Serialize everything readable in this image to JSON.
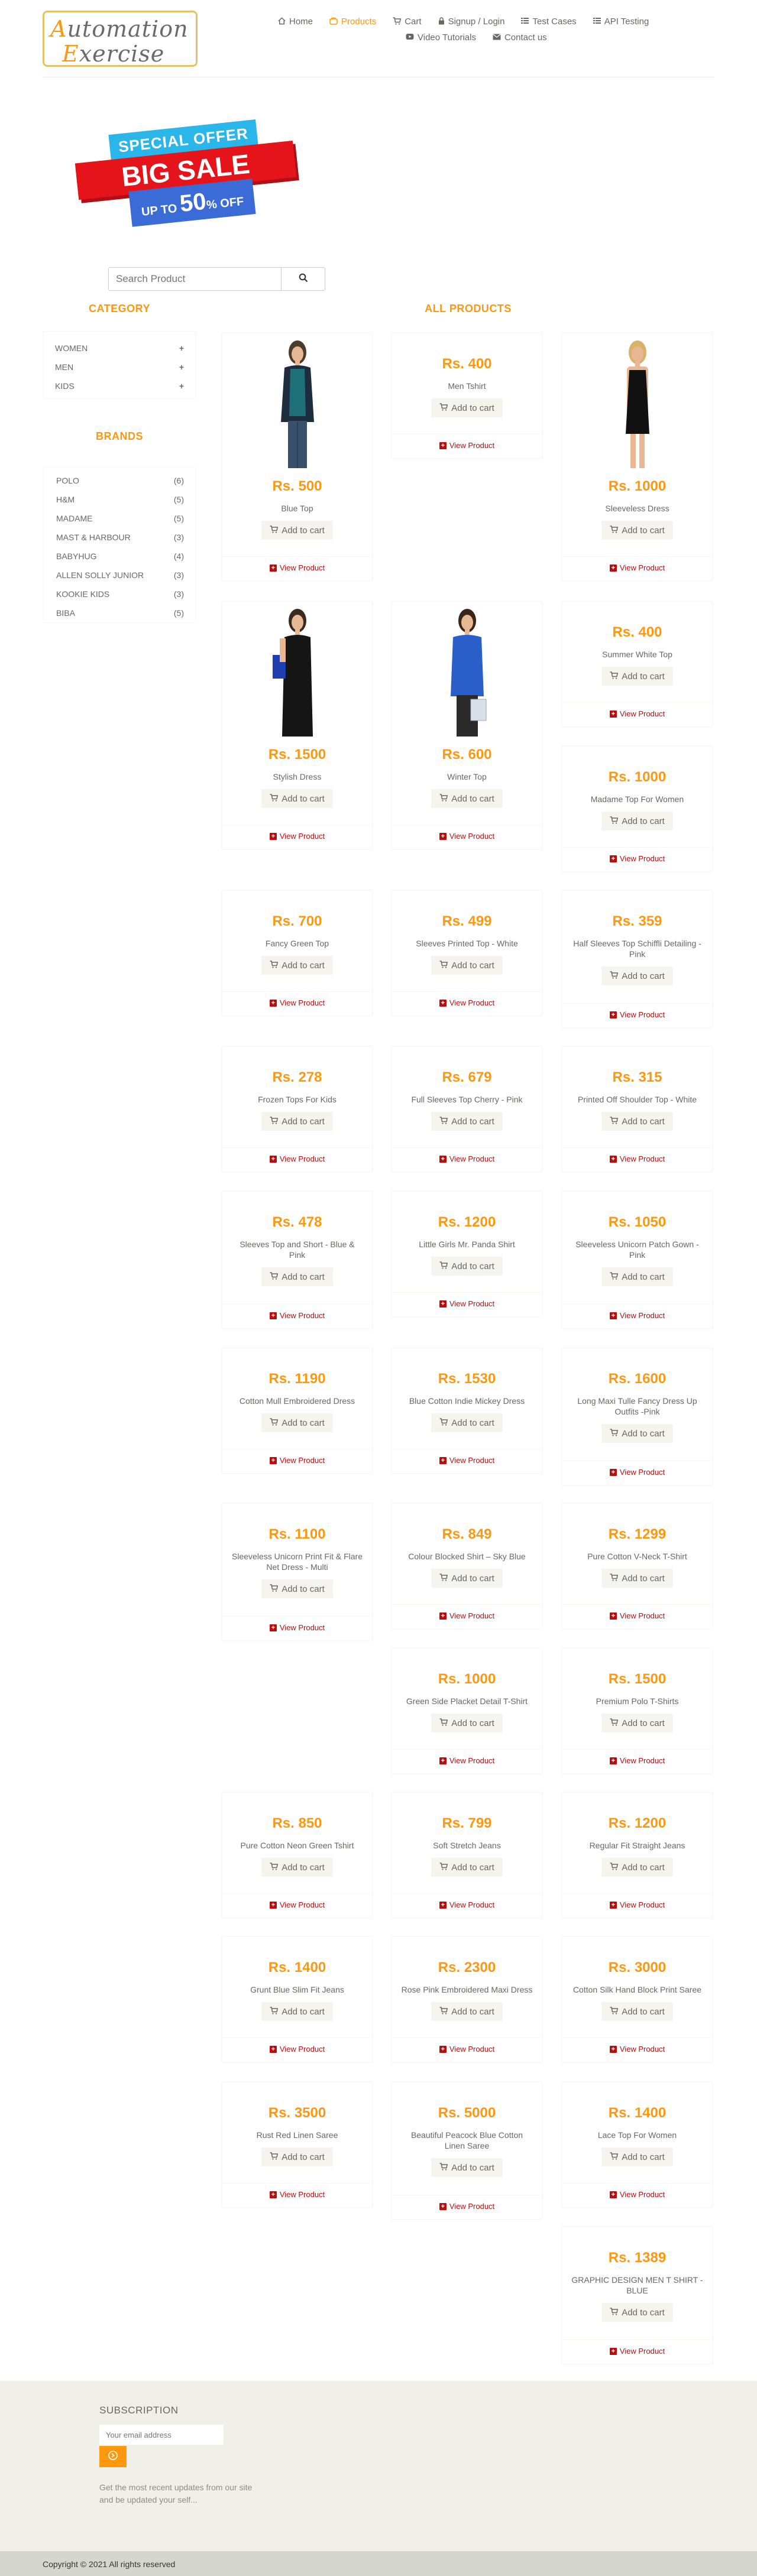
{
  "brand": {
    "logo_line1": "Automation",
    "logo_line2": "Exercise"
  },
  "nav": [
    {
      "label": "Home",
      "icon": "home-icon",
      "active": false
    },
    {
      "label": "Products",
      "icon": "products-icon",
      "active": true
    },
    {
      "label": "Cart",
      "icon": "cart-icon",
      "active": false
    },
    {
      "label": "Signup / Login",
      "icon": "lock-icon",
      "active": false
    },
    {
      "label": "Test Cases",
      "icon": "list-icon",
      "active": false
    },
    {
      "label": "API Testing",
      "icon": "list-icon",
      "active": false
    },
    {
      "label": "Video Tutorials",
      "icon": "youtube-icon",
      "active": false
    },
    {
      "label": "Contact us",
      "icon": "envelope-icon",
      "active": false
    }
  ],
  "banner": {
    "top": "SPECIAL OFFER",
    "mid": "BIG SALE",
    "up_to": "UP TO",
    "percent": "50",
    "pct_sign": "%",
    "off": "OFF"
  },
  "search": {
    "placeholder": "Search Product"
  },
  "sidebar": {
    "category_title": "CATEGORY",
    "categories": [
      {
        "label": "WOMEN"
      },
      {
        "label": "MEN"
      },
      {
        "label": "KIDS"
      }
    ],
    "brands_title": "BRANDS",
    "brands": [
      {
        "label": "POLO",
        "count": "(6)"
      },
      {
        "label": "H&M",
        "count": "(5)"
      },
      {
        "label": "MADAME",
        "count": "(5)"
      },
      {
        "label": "MAST & HARBOUR",
        "count": "(3)"
      },
      {
        "label": "BABYHUG",
        "count": "(4)"
      },
      {
        "label": "ALLEN SOLLY JUNIOR",
        "count": "(3)"
      },
      {
        "label": "KOOKIE KIDS",
        "count": "(3)"
      },
      {
        "label": "BIBA",
        "count": "(5)"
      }
    ]
  },
  "products_title": "ALL PRODUCTS",
  "add_to_cart": "Add to cart",
  "view_product": "View Product",
  "products": [
    {
      "price": "Rs. 500",
      "name": "Blue Top"
    },
    {
      "price": "Rs. 400",
      "name": "Men Tshirt"
    },
    {
      "price": "Rs. 1000",
      "name": "Sleeveless Dress"
    },
    {
      "price": "Rs. 1500",
      "name": "Stylish Dress"
    },
    {
      "price": "Rs. 600",
      "name": "Winter Top"
    },
    {
      "price": "Rs. 400",
      "name": "Summer White Top"
    },
    {
      "price": "Rs. 1000",
      "name": "Madame Top For Women"
    },
    {
      "price": "Rs. 700",
      "name": "Fancy Green Top"
    },
    {
      "price": "Rs. 499",
      "name": "Sleeves Printed Top - White"
    },
    {
      "price": "Rs. 359",
      "name": "Half Sleeves Top Schiffli Detailing - Pink"
    },
    {
      "price": "Rs. 278",
      "name": "Frozen Tops For Kids"
    },
    {
      "price": "Rs. 679",
      "name": "Full Sleeves Top Cherry - Pink"
    },
    {
      "price": "Rs. 315",
      "name": "Printed Off Shoulder Top - White"
    },
    {
      "price": "Rs. 478",
      "name": "Sleeves Top and Short - Blue & Pink"
    },
    {
      "price": "Rs. 1200",
      "name": "Little Girls Mr. Panda Shirt"
    },
    {
      "price": "Rs. 1050",
      "name": "Sleeveless Unicorn Patch Gown - Pink"
    },
    {
      "price": "Rs. 1190",
      "name": "Cotton Mull Embroidered Dress"
    },
    {
      "price": "Rs. 1530",
      "name": "Blue Cotton Indie Mickey Dress"
    },
    {
      "price": "Rs. 1600",
      "name": "Long Maxi Tulle Fancy Dress Up Outfits -Pink"
    },
    {
      "price": "Rs. 1100",
      "name": "Sleeveless Unicorn Print Fit & Flare Net Dress - Multi"
    },
    {
      "price": "Rs. 849",
      "name": "Colour Blocked Shirt – Sky Blue"
    },
    {
      "price": "Rs. 1299",
      "name": "Pure Cotton V-Neck T-Shirt"
    },
    {
      "price": "Rs. 1000",
      "name": "Green Side Placket Detail T-Shirt"
    },
    {
      "price": "Rs. 1500",
      "name": "Premium Polo T-Shirts"
    },
    {
      "price": "Rs. 850",
      "name": "Pure Cotton Neon Green Tshirt"
    },
    {
      "price": "Rs. 799",
      "name": "Soft Stretch Jeans"
    },
    {
      "price": "Rs. 1200",
      "name": "Regular Fit Straight Jeans"
    },
    {
      "price": "Rs. 1400",
      "name": "Grunt Blue Slim Fit Jeans"
    },
    {
      "price": "Rs. 2300",
      "name": "Rose Pink Embroidered Maxi Dress"
    },
    {
      "price": "Rs. 3000",
      "name": "Cotton Silk Hand Block Print Saree"
    },
    {
      "price": "Rs. 3500",
      "name": "Rust Red Linen Saree"
    },
    {
      "price": "Rs. 5000",
      "name": "Beautiful Peacock Blue Cotton Linen Saree"
    },
    {
      "price": "Rs. 1400",
      "name": "Lace Top For Women"
    },
    {
      "price": "Rs. 1389",
      "name": "GRAPHIC DESIGN MEN T SHIRT - BLUE"
    }
  ],
  "footer": {
    "subscription_title": "SUBSCRIPTION",
    "email_placeholder": "Your email address",
    "subscribe_text": "Get the most recent updates from our site and be updated your self...",
    "copyright": "Copyright © 2021 All rights reserved"
  },
  "colors": {
    "accent": "#FE980F",
    "view_link": "#B90E0E",
    "footer_bg": "#F0F0E9"
  }
}
